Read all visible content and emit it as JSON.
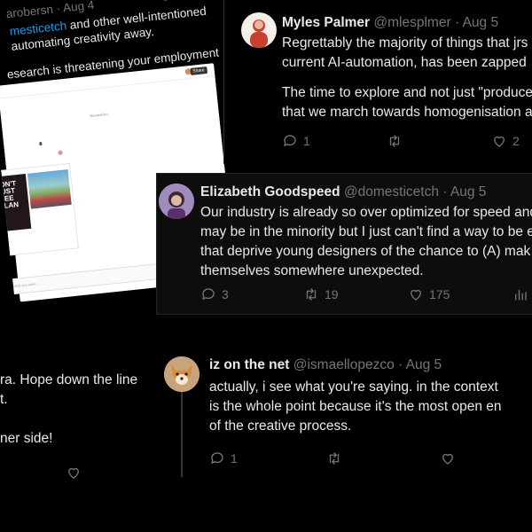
{
  "tweet_top_left": {
    "handle_fragment": "arobersn",
    "date": "Aug 4",
    "line1_mention": "mesticetch",
    "line1_rest": " and other well-intentioned",
    "line2": "automating creativity away.",
    "line3": "esearch is threatening your employment",
    "screenshot": {
      "share_label": "Share",
      "center_text": "NeurosGen",
      "poster_lines": [
        "DON'T",
        "JUST",
        "SEE",
        "MILAN"
      ],
      "input_placeholder": "Describe what you want...",
      "send_glyph": "↑"
    }
  },
  "tweet_top_right": {
    "name": "Myles Palmer",
    "handle": "@mlesplmer",
    "date": "Aug 5",
    "line1": "Regrettably the majority of things that jrs",
    "line2": "current AI-automation, has been zapped",
    "line3": "The time to explore and not just \"produce",
    "line4": "that we march towards homogenisation a",
    "reply_count": "1",
    "like_count": "2"
  },
  "tweet_middle": {
    "name": "Elizabeth Goodspeed",
    "handle": "@domesticetch",
    "date": "Aug 5",
    "line1": "Our industry is already so over optimized for speed and",
    "line2": "may be in the minority but I just can't find a way to be e",
    "line3": "that deprive young designers of the chance to (A) mak",
    "line4": "themselves somewhere unexpected.",
    "reply_count": "3",
    "retweet_count": "19",
    "like_count": "175"
  },
  "tweet_bottom_left": {
    "line1": "ra. Hope down the line",
    "line2": "t.",
    "line3": "ner side!"
  },
  "tweet_bottom_right": {
    "name": "iz on the net",
    "handle": "@ismaellopezco",
    "date": "Aug 5",
    "line1": "actually, i see what you're saying. in the context",
    "line2": "is the whole point because it's the most open en",
    "line3": "of the creative process.",
    "reply_count": "1"
  },
  "colors": {
    "background": "#000000",
    "text": "#e7e9ea",
    "muted": "#71767b",
    "link": "#1d9bf0"
  }
}
